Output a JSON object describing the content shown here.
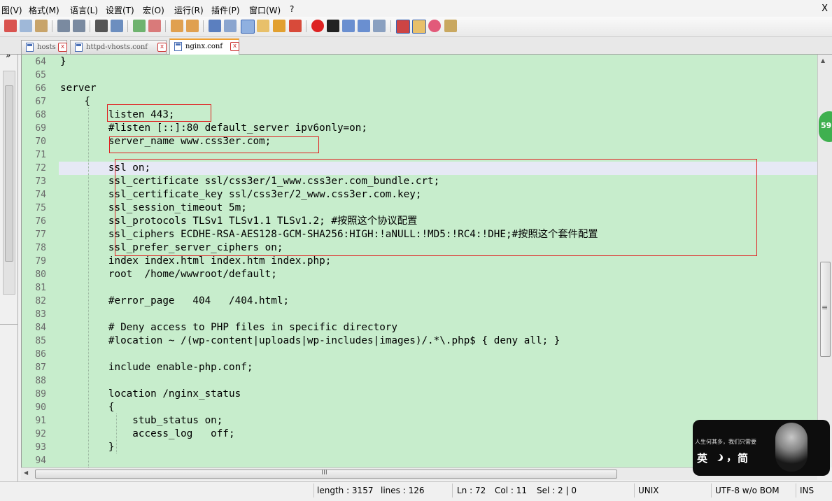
{
  "menu": [
    {
      "label": "图(V)"
    },
    {
      "label": "格式(M)"
    },
    {
      "label": "语言(L)"
    },
    {
      "label": "设置(T)"
    },
    {
      "label": "宏(O)"
    },
    {
      "label": "运行(R)"
    },
    {
      "label": "插件(P)"
    },
    {
      "label": "窗口(W)"
    },
    {
      "label": "?"
    }
  ],
  "window_close": "X",
  "tabs": [
    {
      "label": "hosts",
      "active": false
    },
    {
      "label": "httpd-vhosts.conf",
      "active": false
    },
    {
      "label": "nginx.conf",
      "active": true
    }
  ],
  "panel": {
    "close": "×",
    "expand": "»"
  },
  "editor": {
    "current_line": 72,
    "lines": [
      {
        "n": "64",
        "text": "}"
      },
      {
        "n": "65",
        "text": ""
      },
      {
        "n": "66",
        "text": "server"
      },
      {
        "n": "67",
        "text": "    {"
      },
      {
        "n": "68",
        "text": "        listen 443;"
      },
      {
        "n": "69",
        "text": "        #listen [::]:80 default_server ipv6only=on;"
      },
      {
        "n": "70",
        "text": "        server_name www.css3er.com;"
      },
      {
        "n": "71",
        "text": ""
      },
      {
        "n": "72",
        "text": "        ssl on;"
      },
      {
        "n": "73",
        "text": "        ssl_certificate ssl/css3er/1_www.css3er.com_bundle.crt;"
      },
      {
        "n": "74",
        "text": "        ssl_certificate_key ssl/css3er/2_www.css3er.com.key;"
      },
      {
        "n": "75",
        "text": "        ssl_session_timeout 5m;"
      },
      {
        "n": "76",
        "text": "        ssl_protocols TLSv1 TLSv1.1 TLSv1.2; #按照这个协议配置"
      },
      {
        "n": "77",
        "text": "        ssl_ciphers ECDHE-RSA-AES128-GCM-SHA256:HIGH:!aNULL:!MD5:!RC4:!DHE;#按照这个套件配置"
      },
      {
        "n": "78",
        "text": "        ssl_prefer_server_ciphers on;"
      },
      {
        "n": "79",
        "text": "        index index.html index.htm index.php;"
      },
      {
        "n": "80",
        "text": "        root  /home/wwwroot/default;"
      },
      {
        "n": "81",
        "text": ""
      },
      {
        "n": "82",
        "text": "        #error_page   404   /404.html;"
      },
      {
        "n": "83",
        "text": ""
      },
      {
        "n": "84",
        "text": "        # Deny access to PHP files in specific directory"
      },
      {
        "n": "85",
        "text": "        #location ~ /(wp-content|uploads|wp-includes|images)/.*\\.php$ { deny all; }"
      },
      {
        "n": "86",
        "text": ""
      },
      {
        "n": "87",
        "text": "        include enable-php.conf;"
      },
      {
        "n": "88",
        "text": ""
      },
      {
        "n": "89",
        "text": "        location /nginx_status"
      },
      {
        "n": "90",
        "text": "        {"
      },
      {
        "n": "91",
        "text": "            stub_status on;"
      },
      {
        "n": "92",
        "text": "            access_log   off;"
      },
      {
        "n": "93",
        "text": "        }"
      },
      {
        "n": "94",
        "text": ""
      }
    ]
  },
  "hscroll_label": "III",
  "vscroll_grip": "≡",
  "status": {
    "length": "length : 3157",
    "lines": "lines : 126",
    "ln": "Ln : 72",
    "col": "Col : 11",
    "sel": "Sel : 2 | 0",
    "eol": "UNIX",
    "encoding": "UTF-8 w/o BOM",
    "mode": "INS"
  },
  "badge": "59",
  "ime": {
    "text": "人生何其多，我们只需要",
    "lang": "英",
    "punct": "，",
    "mode": "简"
  },
  "colors": {
    "editor_bg": "#c7edcc",
    "current_line": "#e6e9f5",
    "highlight_box": "#e02020"
  }
}
